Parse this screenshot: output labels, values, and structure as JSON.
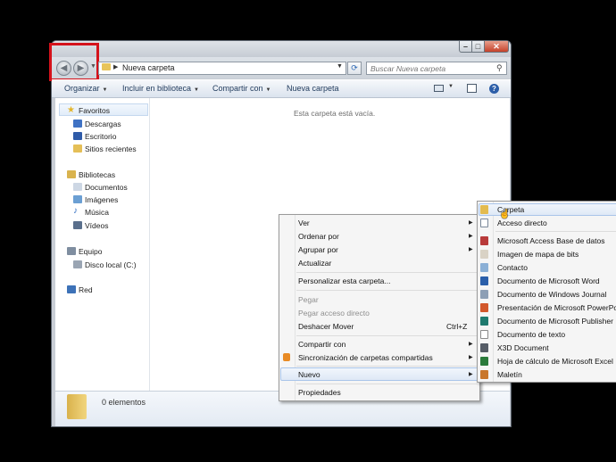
{
  "window": {
    "address_path": "Nueva carpeta",
    "search_placeholder": "Buscar Nueva carpeta",
    "minimize": "–",
    "maximize": "□",
    "close": "✕"
  },
  "toolbar": {
    "organize": "Organizar",
    "include": "Incluir en biblioteca",
    "share": "Compartir con",
    "new_folder": "Nueva carpeta"
  },
  "navigation": {
    "favorites_header": "Favoritos",
    "favorites": [
      "Descargas",
      "Escritorio",
      "Sitios recientes"
    ],
    "libraries_header": "Bibliotecas",
    "libraries": [
      "Documentos",
      "Imágenes",
      "Música",
      "Vídeos"
    ],
    "computer_header": "Equipo",
    "computer": [
      "Disco local (C:)"
    ],
    "network_header": "Red"
  },
  "content": {
    "empty_message": "Esta carpeta está vacía."
  },
  "details": {
    "item_count": "0 elementos"
  },
  "context_menu": {
    "ver": "Ver",
    "ordenar": "Ordenar por",
    "agrupar": "Agrupar por",
    "actualizar": "Actualizar",
    "personalizar": "Personalizar esta carpeta...",
    "pegar": "Pegar",
    "pegar_acceso": "Pegar acceso directo",
    "deshacer": "Deshacer Mover",
    "deshacer_shortcut": "Ctrl+Z",
    "compartir": "Compartir con",
    "sincronizacion": "Sincronización de carpetas compartidas",
    "nuevo": "Nuevo",
    "propiedades": "Propiedades"
  },
  "submenu": {
    "items": [
      "Carpeta",
      "Acceso directo",
      "Microsoft Access Base de datos",
      "Imagen de mapa de bits",
      "Contacto",
      "Documento de Microsoft Word",
      "Documento de Windows Journal",
      "Presentación de Microsoft PowerPoint",
      "Documento de Microsoft Publisher",
      "Documento de texto",
      "X3D Document",
      "Hoja de cálculo de Microsoft Excel",
      "Maletín"
    ]
  },
  "colors": {
    "highlight_frame": "#d4121b",
    "menu_hover": "#dfe9f6",
    "toolbar_text": "#1e395b"
  }
}
